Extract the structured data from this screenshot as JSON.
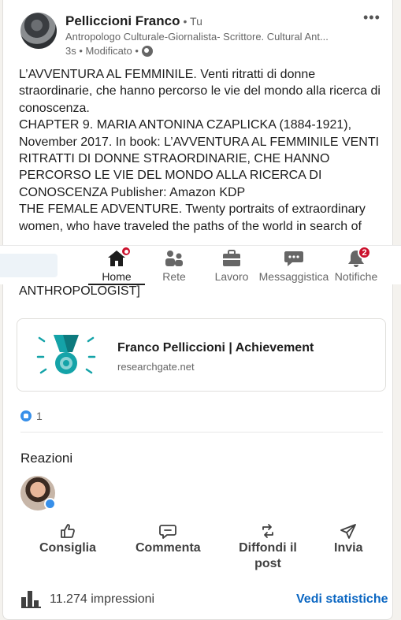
{
  "post": {
    "author_name": "Pelliccioni Franco",
    "author_relation": "• Tu",
    "headline": "Antropologo Culturale-Giornalista- Scrittore. Cultural Ant...",
    "meta": "3s • Modificato •",
    "paragraphs": [
      "L’AVVENTURA AL FEMMINILE. Venti ritratti di donne straordinarie, che hanno percorso le vie del mondo alla ricerca di conoscenza.",
      "CHAPTER 9. MARIA ANTONINA CZAPLICKA (1884-1921), November 2017. In book: L’AVVENTURA AL FEMMINILE VENTI RITRATTI DI DONNE STRAORDINARIE, CHE HANNO PERCORSO LE VIE DEL MONDO ALLA RICERCA DI CONOSCENZA Publisher: Amazon KDP",
      "THE FEMALE ADVENTURE. Twenty portraits of extraordinary women, who have traveled the paths of the world in search of"
    ],
    "text_tail": "ANTHROPOLOGIST]"
  },
  "nav": {
    "items": [
      {
        "label": "Home",
        "icon": "home-icon",
        "active": true
      },
      {
        "label": "Rete",
        "icon": "network-icon"
      },
      {
        "label": "Lavoro",
        "icon": "briefcase-icon"
      },
      {
        "label": "Messaggistica",
        "icon": "messaging-icon"
      },
      {
        "label": "Notifiche",
        "icon": "bell-icon",
        "badge": "2"
      }
    ]
  },
  "preview": {
    "title": "Franco Pelliccioni | Achievement",
    "domain": "researchgate.net"
  },
  "reactions": {
    "count": "1",
    "section_title": "Reazioni"
  },
  "actions": {
    "like": "Consiglia",
    "comment": "Commenta",
    "repost": "Diffondi il post",
    "send": "Invia"
  },
  "footer": {
    "impressions": "11.274 impressioni",
    "stats_link": "Vedi statistiche"
  },
  "colors": {
    "accent": "#0a66c2",
    "badge": "#cb112d",
    "like": "#378fe9",
    "achievement": "#14a3a8"
  }
}
